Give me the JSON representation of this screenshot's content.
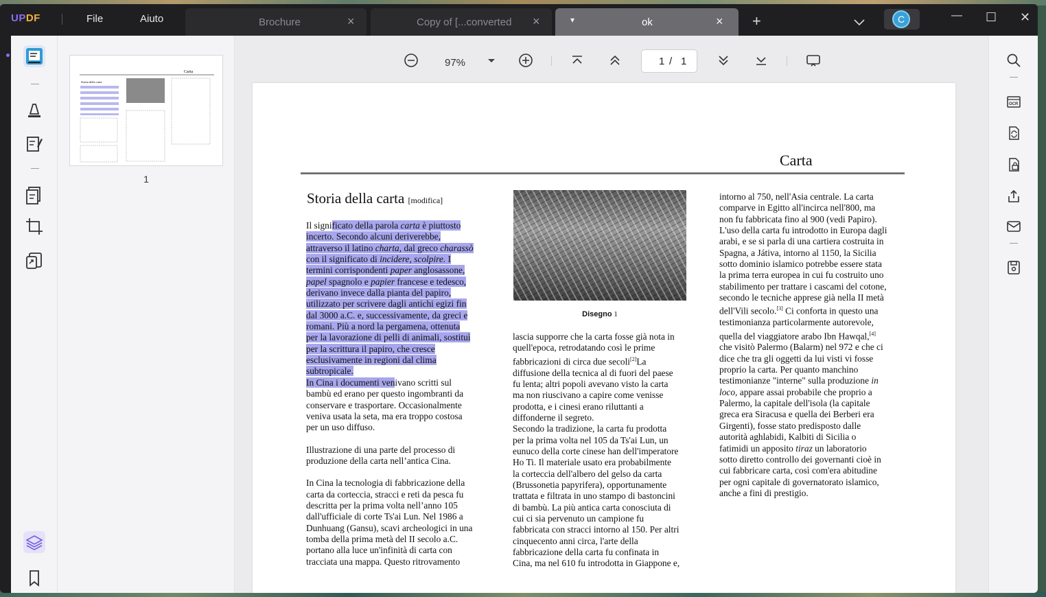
{
  "app": {
    "logo_a": "UP",
    "logo_b": "DF",
    "menu_file": "File",
    "menu_help": "Aiuto"
  },
  "tabs": [
    {
      "label": "Brochure",
      "close": "×"
    },
    {
      "label": "Copy of [...converted",
      "close": "×"
    },
    {
      "label": "ok",
      "close": "×",
      "dropdown": "▾"
    }
  ],
  "titlebar": {
    "new_tab": "+",
    "tabs_menu": "⌄",
    "avatar_letter": "C",
    "minimize": "—",
    "maximize": "☐",
    "close": "✕"
  },
  "thumbnails": {
    "page_label": "1"
  },
  "viewer": {
    "zoom": "97%",
    "current_page": "1",
    "page_sep": "/",
    "total_pages": "1"
  },
  "document": {
    "title": "Carta",
    "heading": "Storia della carta",
    "heading_edit": "[modifica]",
    "col1_p1_hl": [
      "Il signi",
      "ficato della parola ",
      "carta",
      " è piuttosto",
      "incerto. Secondo alcuni deriverebbe,",
      "attraverso il latino ",
      "charta,",
      " dal greco ",
      "charassò",
      "con il significato di ",
      "incidere, scolpire.",
      " I",
      "termini corrispondenti ",
      "paper",
      " anglosassone,",
      "papel",
      " spagnolo e ",
      "papier",
      " francese e tedesco,",
      "derivano invece dalla pianta del papiro,",
      "utilizzato per scrivere dagli antichi egizi fin",
      "dal 3000 a.C. e, successivamente, da greci e",
      "romani. Più a nord la pergamena, ottenuta",
      "per la lavorazione di pelli di animali, sostituì",
      "per la scrittura il papiro, che cresce",
      "esclusivamente in regioni dal clima",
      "subtropicale."
    ],
    "col1_p2": [
      "In Cina i documenti ven",
      "ivano scritti sul",
      "bambù ed erano per questo ingombranti da",
      "conservare e trasportare. Occasionalmente",
      "veniva usata la seta, ma era troppo costosa",
      "per un uso diffuso."
    ],
    "col1_p3": [
      "Illustrazione di una parte del processo di",
      "produzione della carta nell’antica Cina."
    ],
    "col1_p4": [
      "In Cina la tecnologia di fabbricazione della",
      "carta da corteccia, stracci e reti da pesca fu",
      "descritta per la prima volta nell’anno 105",
      "dall'ufficiale di corte Ts'ai Lun. Nel 1986 a",
      "Dunhuang (Gansu), scavi archeologici in una",
      "tomba della prima metà del II secolo a.C.",
      "portano alla luce un'infinità di carta con",
      "tracciata una mappa. Questo ritrovamento"
    ],
    "caption_bold": "Disegno",
    "caption_num": "1",
    "col2": [
      "lascia supporre che la carta fosse già nota in",
      "quell'epoca, retrodatando così le prime",
      "fabbricazioni di circa due secoli",
      "La",
      "diffusione della tecnica al di fuori del paese",
      "fu lenta; altri popoli avevano visto la carta",
      "ma non riuscivano a capire come venisse",
      "prodotta, e i cinesi erano riluttanti a",
      "diffonderne il segreto.",
      "Secondo la tradizione, la carta fu prodotta",
      "per la prima volta nel 105 da Ts'ai Lun, un",
      "eunuco della corte cinese han dell'imperatore",
      "Ho Ti. Il materiale usato era probabilmente",
      "la corteccia dell'albero del gelso da carta",
      "(Brussonetia papyrifera), opportunamente",
      "trattata e filtrata in uno stampo di bastoncini",
      "di bambù. La più antica carta conosciuta di",
      "cui ci sia pervenuto un campione fu",
      "fabbricata con stracci intorno al 150. Per altri",
      "cinquecento anni circa, l'arte della",
      "fabbricazione della carta fu confinata in",
      "Cina, ma nel 610 fu introdotta in Giappone e,"
    ],
    "col2_sup": "[2]",
    "col3": [
      "intorno al 750, nell'Asia centrale. La carta",
      "comparve in Egitto all'incirca nell'800, ma",
      "non fu fabbricata fino al 900 (vedi Papiro).",
      "L'uso della carta fu introdotto in Europa dagli",
      "arabi, e se si parla di una cartiera costruita in",
      "Spagna, a Játiva, intorno al 1150, la Sicilia",
      "sotto dominio islamico potrebbe essere stata",
      "la prima terra europea in cui fu costruito uno",
      "stabilimento per trattare i cascami del cotone,",
      "secondo le tecniche apprese già nella II metà",
      "dell'Vili secolo.",
      " Ci conforta in questo una",
      "testimonianza particolarmente autorevole,",
      "quella del viaggiatore arabo Ibn Hawqal,",
      "che visitò Palermo (Balarm) nel 972 e che ci",
      "dice che tra gli oggetti da lui visti vi fosse",
      "proprio la carta. Per quanto manchino",
      "testimonianze \"interne\" sulla produzione ",
      "in loco,",
      " appare assai probabile che proprio a",
      "Palermo, la capitale dell'isola (la capitale",
      "greca era Siracusa e quella dei Berberi era",
      "Girgenti), fosse stato predisposto dalle",
      "autorità aghlabidi, Kalbiti di Sicilia o",
      "fatimidi un apposito ",
      "tiraz",
      " un laboratorio",
      "sotto diretto controllo dei governanti cioè in",
      "cui fabbricare carta, così com'era abitudine",
      "per ogni capitale di governatorato islamico,",
      "anche a fini di prestigio."
    ],
    "col3_sup1": "[3]",
    "col3_sup2": "[4]"
  },
  "colors": {
    "accent": "#8f6cf0",
    "brand_yellow": "#f4b43a",
    "highlight": "#a8a6ec",
    "titlebar": "#1f1f22"
  }
}
